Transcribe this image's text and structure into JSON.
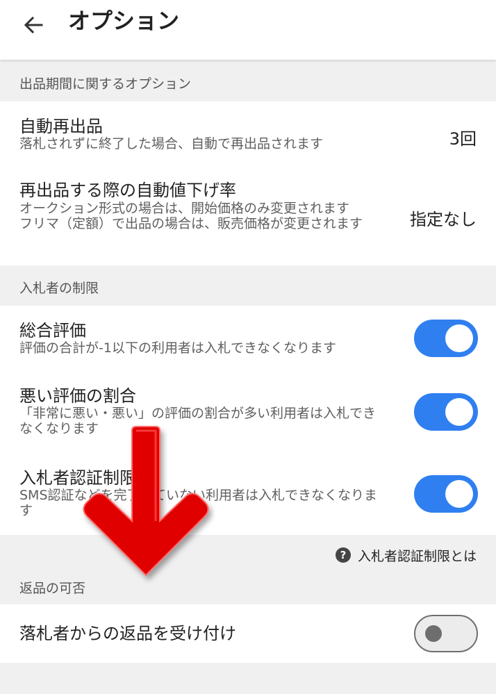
{
  "header": {
    "back_icon": "arrow-left-icon",
    "title": "オプション"
  },
  "sections": {
    "period": {
      "label": "出品期間に関するオプション",
      "auto_relist": {
        "title": "自動再出品",
        "description": "落札されずに終了した場合、自動で再出品されます",
        "value": "3回"
      },
      "auto_price_down": {
        "title": "再出品する際の自動値下げ率",
        "description_line1": "オークション形式の場合は、開始価格のみ変更されます",
        "description_line2": "フリマ（定額）で出品の場合は、販売価格が変更されます",
        "value": "指定なし"
      }
    },
    "bidder_limits": {
      "label": "入札者の制限",
      "overall_rating": {
        "title": "総合評価",
        "description": "評価の合計が-1以下の利用者は入札できなくなります",
        "enabled": true
      },
      "bad_rating_ratio": {
        "title": "悪い評価の割合",
        "description": "「非常に悪い・悪い」の評価の割合が多い利用者は入札できなくなります",
        "enabled": true
      },
      "bidder_verification": {
        "title": "入札者認証制限",
        "description": "SMS認証などを完了していない利用者は入札できなくなります",
        "enabled": true
      },
      "help_link": {
        "icon": "question-circle-icon",
        "label": "入札者認証制限とは"
      }
    },
    "returns": {
      "label": "返品の可否",
      "accept_returns": {
        "title": "落札者からの返品を受け付け",
        "enabled": false
      }
    }
  },
  "overlay": {
    "icon": "red-down-arrow-icon"
  },
  "colors": {
    "toggle_on": "#2f7ff0",
    "toggle_off": "#ececec",
    "overlay_arrow": "#e00000",
    "section_background": "#f0f0f0"
  }
}
